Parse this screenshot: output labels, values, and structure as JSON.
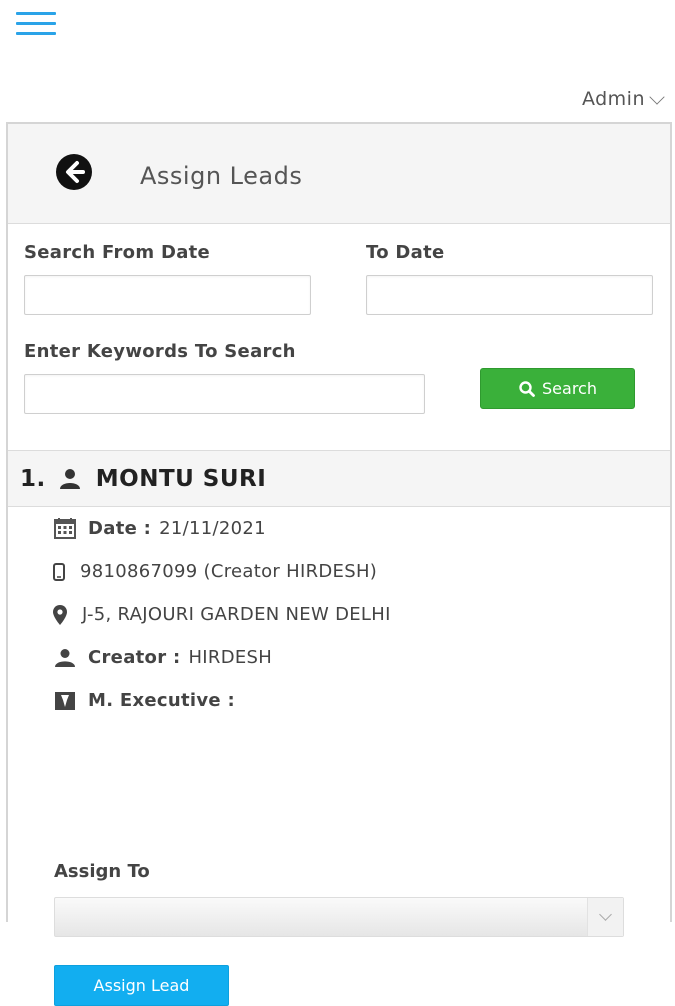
{
  "topbar": {
    "menu_icon": "hamburger-icon",
    "user_label": "Admin",
    "user_chevron_icon": "chevron-down-icon"
  },
  "page": {
    "back_icon": "arrow-left-circle-icon",
    "title": "Assign Leads"
  },
  "filters": {
    "from_date_label": "Search From Date",
    "from_date_value": "",
    "to_date_label": "To Date",
    "to_date_value": "",
    "keywords_label": "Enter Keywords To Search",
    "keywords_value": "",
    "search_button_label": "Search",
    "search_icon": "search-icon"
  },
  "lead": {
    "number": "1.",
    "name": "MONTU SURI",
    "name_icon": "user-icon",
    "date_label": "Date :",
    "date_value": "21/11/2021",
    "date_icon": "calendar-icon",
    "phone_text": "9810867099 (Creator HIRDESH)",
    "phone_icon": "mobile-icon",
    "address": "J-5, RAJOURI GARDEN NEW DELHI",
    "address_icon": "map-marker-icon",
    "creator_label": "Creator :",
    "creator_value": "HIRDESH",
    "creator_icon": "user-icon",
    "executive_label": "M. Executive :",
    "executive_value": "",
    "executive_icon": "id-badge-icon",
    "assign_to_label": "Assign To",
    "assign_to_selected": "",
    "assign_button_label": "Assign Lead"
  },
  "colors": {
    "menu": "#2aa3e8",
    "search_button": "#3ab03a",
    "assign_button": "#12aef0",
    "header_bg": "#f5f5f5"
  }
}
